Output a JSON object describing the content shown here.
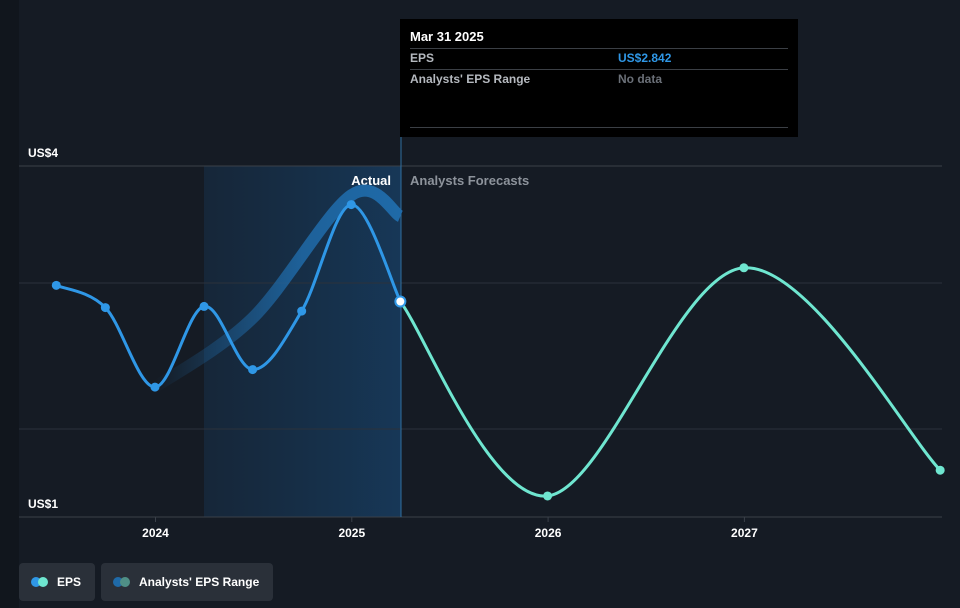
{
  "chart_data": {
    "type": "line",
    "y_axis": {
      "labels": [
        "US$4",
        "US$1"
      ],
      "range": [
        1,
        4
      ]
    },
    "x_axis": {
      "ticks": [
        "2024",
        "2025",
        "2026",
        "2027"
      ]
    },
    "regions": {
      "actual_label": "Actual",
      "forecast_label": "Analysts Forecasts"
    },
    "series": [
      {
        "name": "EPS",
        "color": "#2f97e6",
        "points": [
          {
            "date": "2023-06-30",
            "value": 2.98
          },
          {
            "date": "2023-09-30",
            "value": 2.79
          },
          {
            "date": "2023-12-31",
            "value": 2.11
          },
          {
            "date": "2024-03-31",
            "value": 2.8
          },
          {
            "date": "2024-06-30",
            "value": 2.26
          },
          {
            "date": "2024-09-30",
            "value": 2.76
          },
          {
            "date": "2024-12-31",
            "value": 3.67
          },
          {
            "date": "2025-03-31",
            "value": 2.842
          }
        ]
      },
      {
        "name": "EPS forecast",
        "color": "#6fe6d0",
        "points": [
          {
            "date": "2025-03-31",
            "value": 2.842
          },
          {
            "date": "2025-12-31",
            "value": 1.18
          },
          {
            "date": "2026-12-31",
            "value": 3.13
          },
          {
            "date": "2027-12-31",
            "value": 1.4
          }
        ]
      },
      {
        "name": "Analysts' EPS Range",
        "color": "#1f6aa8",
        "points": [
          {
            "date": "2023-12-31",
            "value": 2.11
          },
          {
            "date": "2024-06-30",
            "value": 2.7
          },
          {
            "date": "2024-12-31",
            "value": 3.75
          },
          {
            "date": "2025-03-31",
            "value": 3.57
          }
        ]
      }
    ]
  },
  "tooltip": {
    "date": "Mar 31 2025",
    "eps_label": "EPS",
    "eps_value": "US$2.842",
    "range_label": "Analysts' EPS Range",
    "range_value": "No data"
  },
  "legend": [
    {
      "label": "EPS",
      "colors": [
        "#2f97e6",
        "#6fe6d0"
      ]
    },
    {
      "label": "Analysts' EPS Range",
      "colors": [
        "#1f6aa8",
        "#4f8f86"
      ]
    }
  ]
}
